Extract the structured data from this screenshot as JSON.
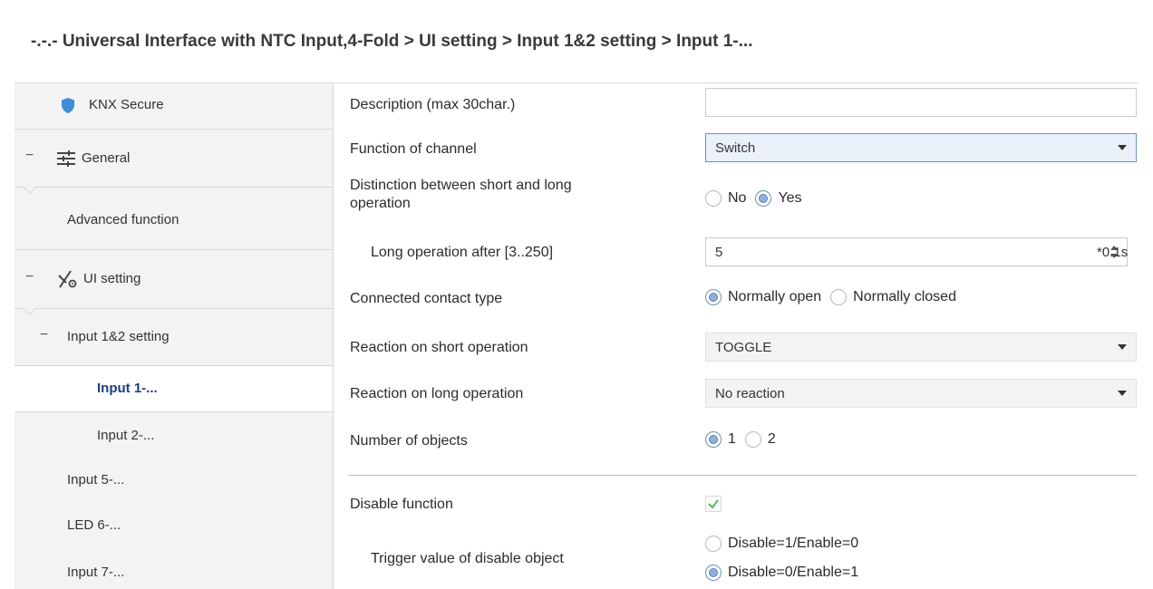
{
  "breadcrumb": "-.-.- Universal Interface with NTC Input,4-Fold > UI setting > Input 1&2 setting > Input 1-...",
  "sidebar": {
    "items": [
      {
        "label": "KNX Secure",
        "icon": "shield-icon"
      },
      {
        "label": "General",
        "icon": "sliders-icon",
        "expander": "−"
      },
      {
        "label": "Advanced function"
      },
      {
        "label": "UI setting",
        "icon": "ui-setting-icon",
        "expander": "−"
      },
      {
        "label": "Input 1&2 setting",
        "expander": "−"
      },
      {
        "label": "Input 1-...",
        "selected": true
      },
      {
        "label": "Input 2-..."
      },
      {
        "label": "Input 5-..."
      },
      {
        "label": "LED 6-..."
      },
      {
        "label": "Input 7-..."
      }
    ]
  },
  "form": {
    "description": {
      "label": "Description (max 30char.)",
      "value": ""
    },
    "function": {
      "label": "Function of channel",
      "value": "Switch"
    },
    "distinction": {
      "label_line1": "Distinction between short and long",
      "label_line2": "operation",
      "options": [
        "No",
        "Yes"
      ],
      "selected": "Yes"
    },
    "long_after": {
      "label": "Long operation after [3..250]",
      "value": "5",
      "unit": "*0.1s"
    },
    "contact_type": {
      "label": "Connected contact type",
      "options": [
        "Normally open",
        "Normally closed"
      ],
      "selected": "Normally open"
    },
    "short_reaction": {
      "label": "Reaction on short operation",
      "value": "TOGGLE"
    },
    "long_reaction": {
      "label": "Reaction on long operation",
      "value": "No reaction"
    },
    "objects": {
      "label": "Number of objects",
      "options": [
        "1",
        "2"
      ],
      "selected": "1"
    },
    "disable": {
      "label": "Disable function",
      "checked": true
    },
    "trigger": {
      "label": "Trigger value of disable object",
      "options": [
        "Disable=1/Enable=0",
        "Disable=0/Enable=1"
      ],
      "selected": "Disable=0/Enable=1"
    }
  },
  "colors": {
    "selected_text": "#1d3e7a",
    "shield": "#3d8fd6",
    "sidebar_bg": "#f3f3f3",
    "check": "#5cb85c"
  }
}
